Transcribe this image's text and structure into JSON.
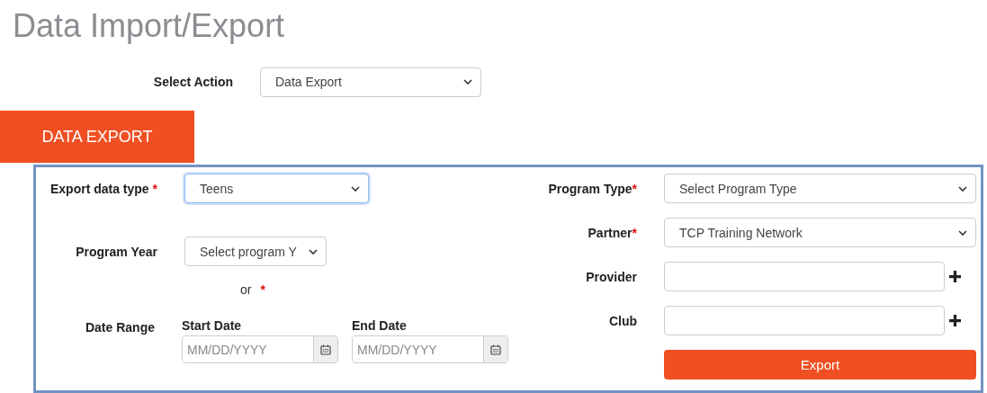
{
  "page_title": "Data Import/Export",
  "action": {
    "label": "Select Action",
    "value": "Data Export"
  },
  "tabs": [
    {
      "label": "DATA EXPORT",
      "selected": true
    }
  ],
  "export_data_type": {
    "label": "Export data type",
    "required_mark": "*",
    "value": "Teens",
    "focused": true
  },
  "program_year": {
    "label": "Program Year",
    "value": "Select program Y"
  },
  "or_note": {
    "text": "or",
    "required_mark": "*"
  },
  "date_range": {
    "label": "Date Range",
    "start": {
      "label": "Start Date",
      "placeholder": "MM/DD/YYYY"
    },
    "end": {
      "label": "End Date",
      "placeholder": "MM/DD/YYYY"
    }
  },
  "right_fields": [
    {
      "kind": "select",
      "label": "Program Type",
      "required_mark": "*",
      "value": "Select Program Type"
    },
    {
      "kind": "select",
      "label": "Partner",
      "required_mark": "*",
      "value": "TCP Training Network"
    },
    {
      "kind": "input",
      "label": "Provider",
      "add": true
    },
    {
      "kind": "input",
      "label": "Club",
      "add": true
    }
  ],
  "export_button": {
    "label": "Export"
  }
}
